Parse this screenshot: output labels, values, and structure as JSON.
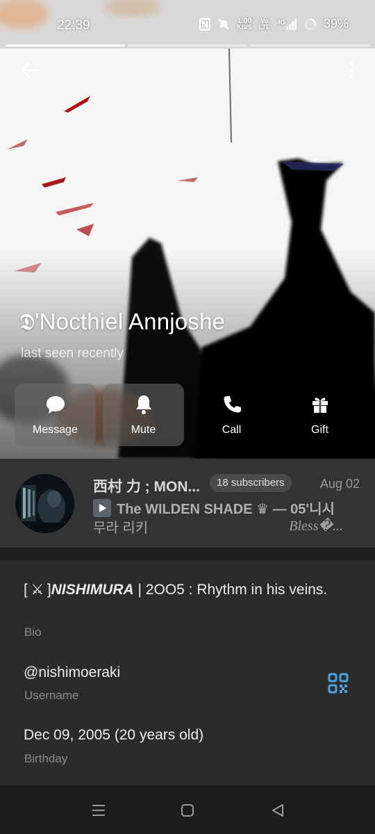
{
  "status_bar": {
    "time": "22:39",
    "net_speed_value": "1.00",
    "net_speed_unit": "KB/S",
    "volte_top": "Vo",
    "volte_bottom": "LTE",
    "network": "4G",
    "battery": "39%"
  },
  "story_progress": [
    1,
    0,
    0
  ],
  "profile": {
    "name": "𝕯'Nocthiel Annjoshe",
    "status": "last seen recently"
  },
  "actions": [
    {
      "label": "Message",
      "icon": "message-icon"
    },
    {
      "label": "Mute",
      "icon": "bell-icon"
    },
    {
      "label": "Call",
      "icon": "phone-icon"
    },
    {
      "label": "Gift",
      "icon": "gift-icon"
    }
  ],
  "channel": {
    "title": "西村 力 ; MON...",
    "subscribers": "18 subscribers",
    "date": "Aug 02",
    "preview_title": "The WILDEN SHADE ♛ — 05'니시",
    "preview_line3": "무라 리키",
    "preview_tail": "Bless�..."
  },
  "info": {
    "bio_prefix": "[",
    "bio_swords": "⚔",
    "bio_close": "]",
    "bio_name": "NISHIMURA",
    "bio_rest": " | 2OO5 : Rhythm in his veins.",
    "bio_label": "Bio",
    "username": "@nishimoeraki",
    "username_label": "Username",
    "birthday": "Dec 09, 2005 (20 years old)",
    "birthday_label": "Birthday"
  },
  "colors": {
    "accent": "#4aa3df",
    "panel": "#2b2b2b",
    "card": "#333333"
  }
}
